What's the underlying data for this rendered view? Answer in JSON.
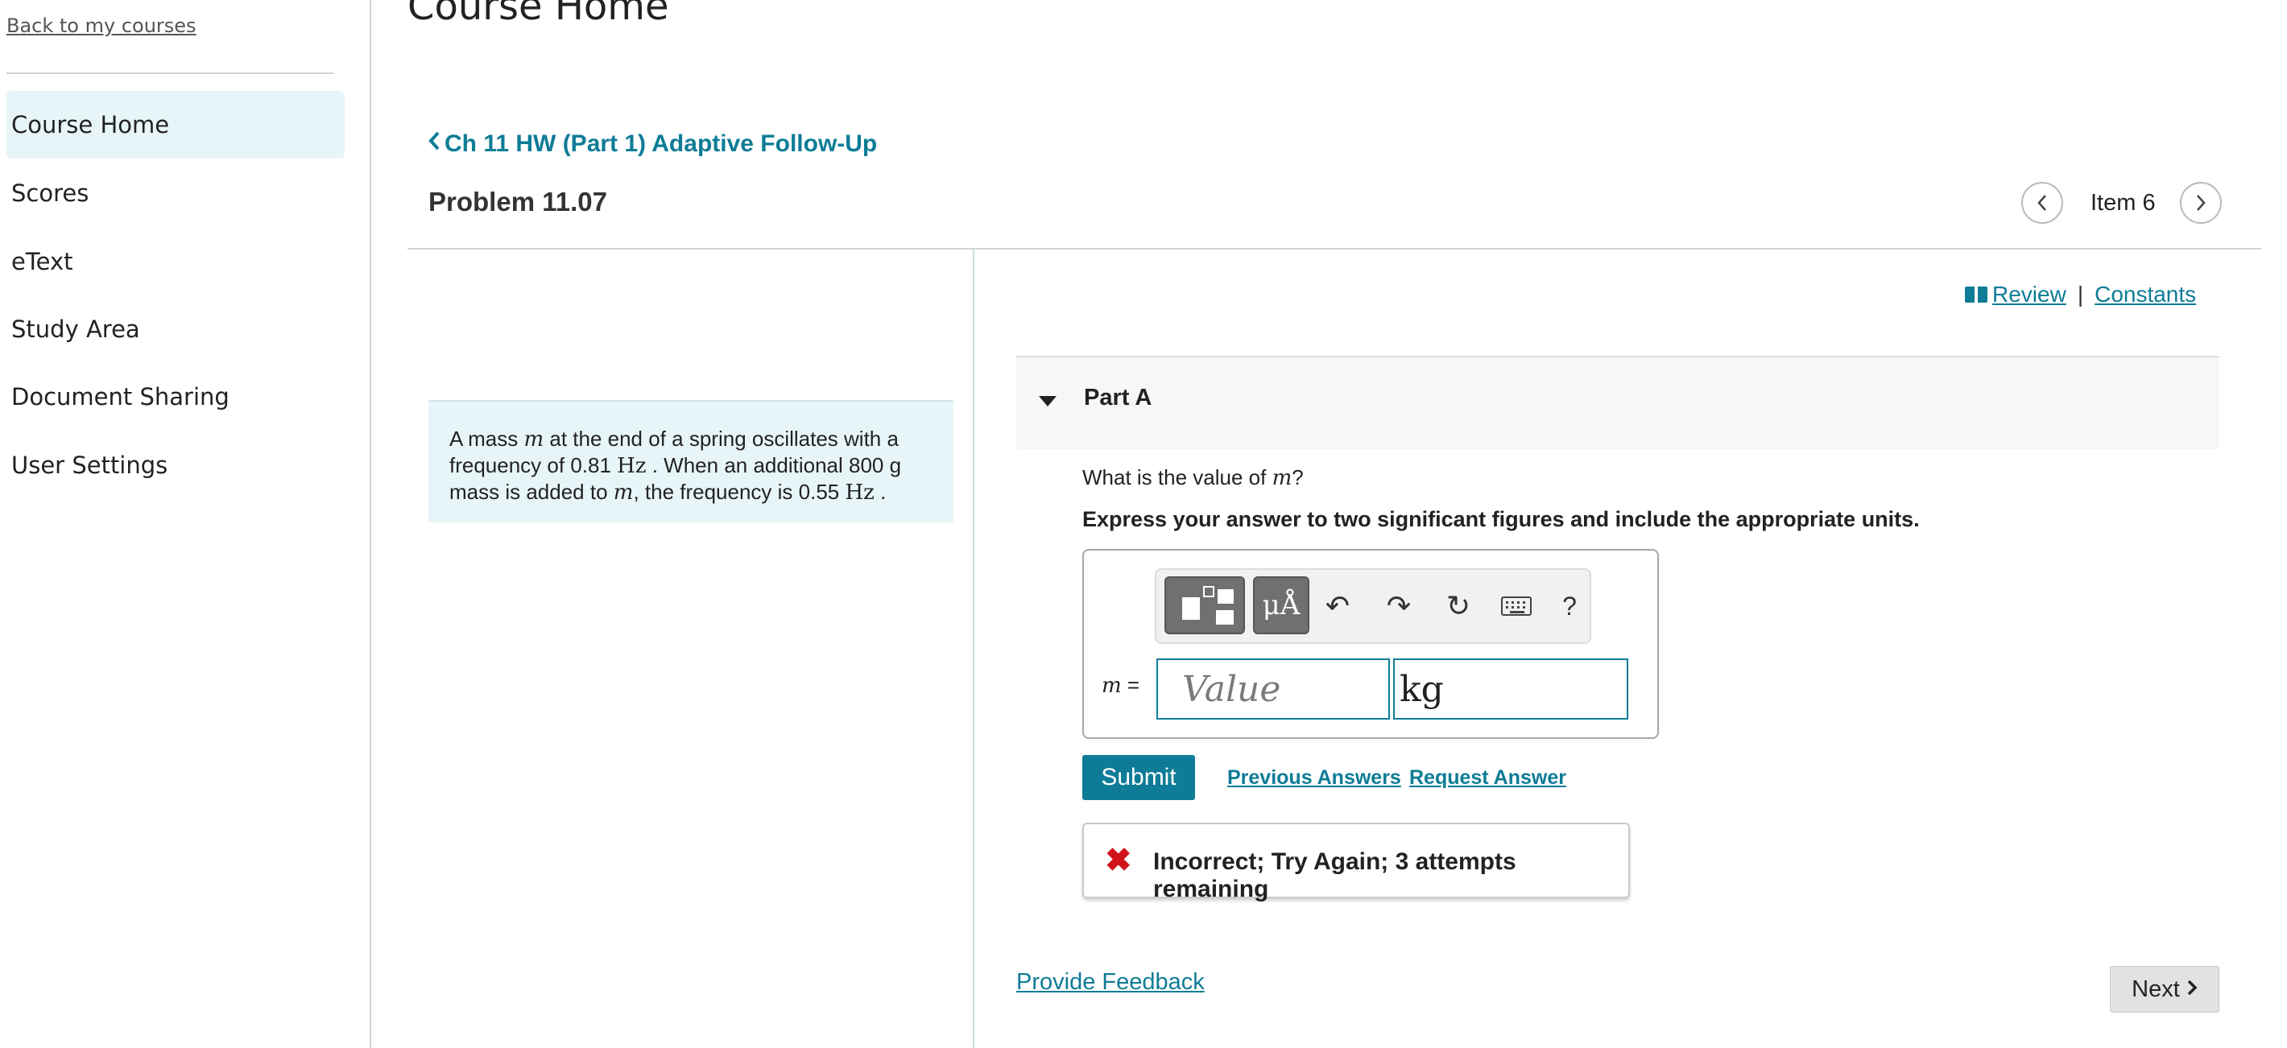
{
  "sidebar": {
    "back_link": "Back to my courses",
    "items": [
      {
        "label": "Course Home",
        "active": true
      },
      {
        "label": "Scores"
      },
      {
        "label": "eText"
      },
      {
        "label": "Study Area"
      },
      {
        "label": "Document Sharing"
      },
      {
        "label": "User Settings"
      }
    ]
  },
  "header": {
    "course_title": "Course Home",
    "assignment_link": "Ch 11 HW (Part 1) Adaptive Follow-Up",
    "problem_title": "Problem 11.07",
    "item_label": "Item 6"
  },
  "intro": {
    "t1": "A mass ",
    "m1": "m",
    "t2": " at the end of a spring oscillates with a frequency of 0.81 ",
    "u1": "Hz",
    "t3": " . When an additional 800 g mass is added to ",
    "m2": "m",
    "t4": ", the frequency is 0.55 ",
    "u2": "Hz",
    "t5": " ."
  },
  "links": {
    "review": "Review",
    "separator": "|",
    "constants": "Constants"
  },
  "part": {
    "label": "Part A",
    "question_prefix": "What is the value of ",
    "question_var": "m",
    "question_suffix": "?",
    "instruction": "Express your answer to two significant figures and include the appropriate units.",
    "toolbar": {
      "units_label": "μÅ",
      "undo": "↶",
      "redo": "↷",
      "reset": "↻",
      "help": "?"
    },
    "answer_label": "m =",
    "value_placeholder": "Value",
    "unit_value": "kg",
    "submit": "Submit",
    "previous_answers": "Previous Answers",
    "request_answer": "Request Answer",
    "feedback": "Incorrect; Try Again; 3 attempts remaining",
    "feedback_icon": "✖"
  },
  "footer": {
    "provide_feedback": "Provide Feedback",
    "next": "Next"
  },
  "colors": {
    "accent": "#0e7c96",
    "active_nav_bg": "#e8f5f8",
    "error": "#d0121b"
  }
}
